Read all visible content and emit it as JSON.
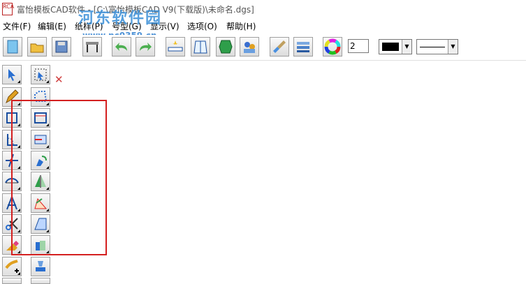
{
  "window": {
    "title": "富怡模板CAD软件 - [C:\\富怡模板CAD V9(下载版)\\未命名.dgs]",
    "app_icon_text": "RCA"
  },
  "watermark": {
    "text": "河东软件园",
    "url": "www.pc0359.cn"
  },
  "menu": [
    "文件(F)",
    "编辑(E)",
    "纸样(P)",
    "号型(G)",
    "显示(V)",
    "选项(O)",
    "帮助(H)"
  ],
  "toolbar": {
    "line_width_value": "2",
    "color_value": "#000000"
  },
  "icons": {
    "new": "new-file-icon",
    "open": "open-folder-icon",
    "save": "save-disk-icon",
    "print": "plotter-icon",
    "undo": "undo-arrow-icon",
    "redo": "redo-arrow-icon",
    "measure": "ruler-star-icon",
    "piece": "pattern-piece-icon",
    "shape": "green-polygon-icon",
    "users": "users-icon",
    "brush": "paint-brush-icon",
    "layers": "layers-icon",
    "color_wheel": "color-wheel-icon"
  },
  "colors": {
    "red_box": "#d42020",
    "watermark": "#3a8fd8"
  }
}
